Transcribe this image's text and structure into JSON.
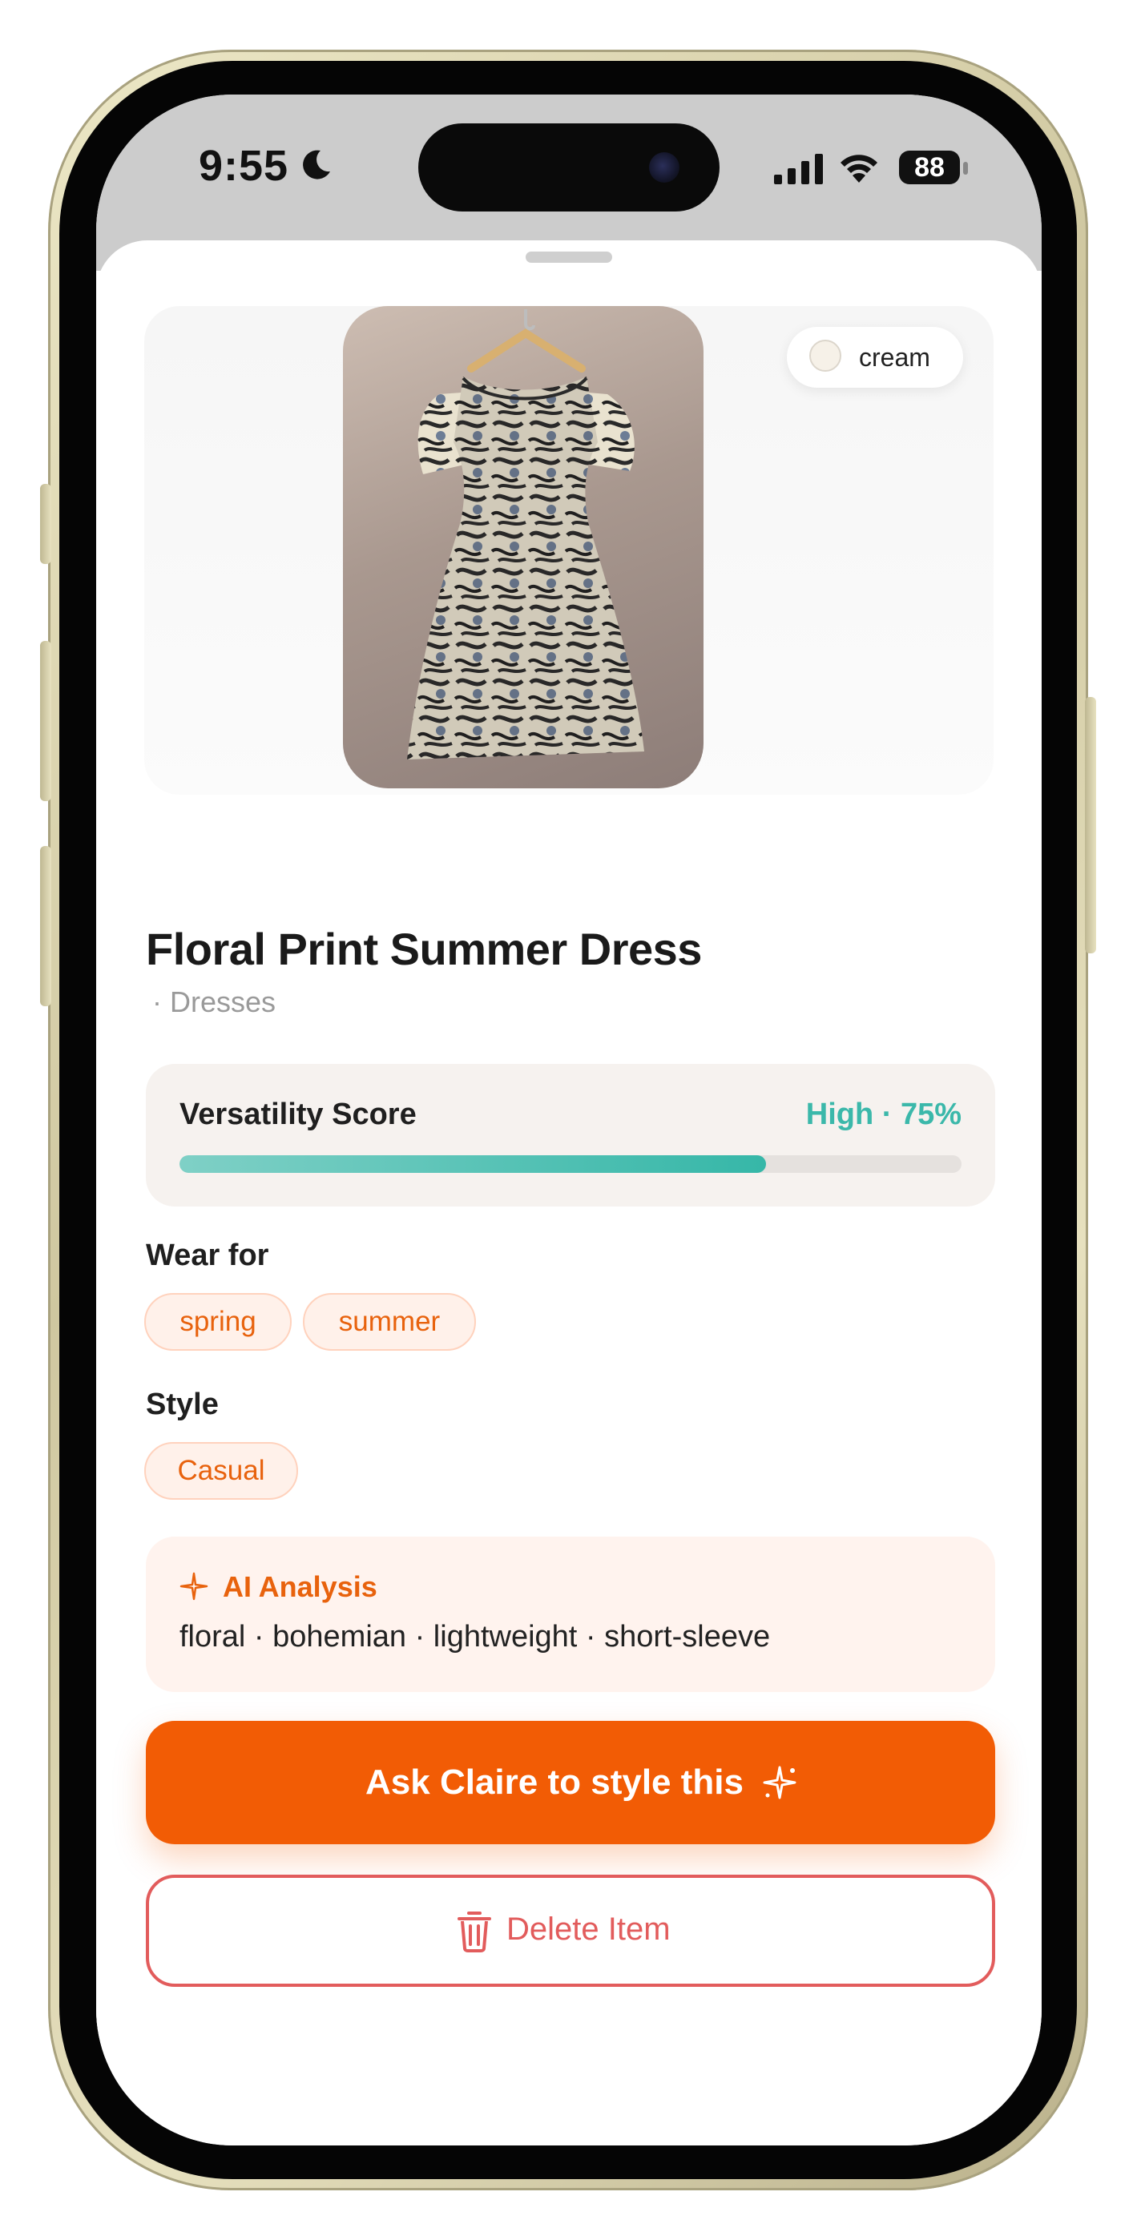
{
  "status_bar": {
    "time": "9:55",
    "battery": "88",
    "icons": [
      "moon-icon",
      "signal-icon",
      "wifi-icon",
      "battery-icon"
    ]
  },
  "item": {
    "color_name": "cream",
    "title": "Floral Print Summer Dress",
    "category": "· Dresses",
    "photo": "dress-photo"
  },
  "versatility": {
    "label": "Versatility Score",
    "value_text": "High · 75%",
    "percent": 75
  },
  "wear_for": {
    "label": "Wear for",
    "seasons": [
      "spring",
      "summer"
    ]
  },
  "style": {
    "label": "Style",
    "tags": [
      "Casual"
    ]
  },
  "ai_analysis": {
    "title": "AI Analysis",
    "tags_text": "floral · bohemian · lightweight · short-sleeve"
  },
  "actions": {
    "style_button": "Ask Claire to style this",
    "delete_button": "Delete Item"
  },
  "colors": {
    "accent_orange": "#f25c05",
    "teal": "#3bb8aa",
    "danger": "#e25c5c"
  }
}
